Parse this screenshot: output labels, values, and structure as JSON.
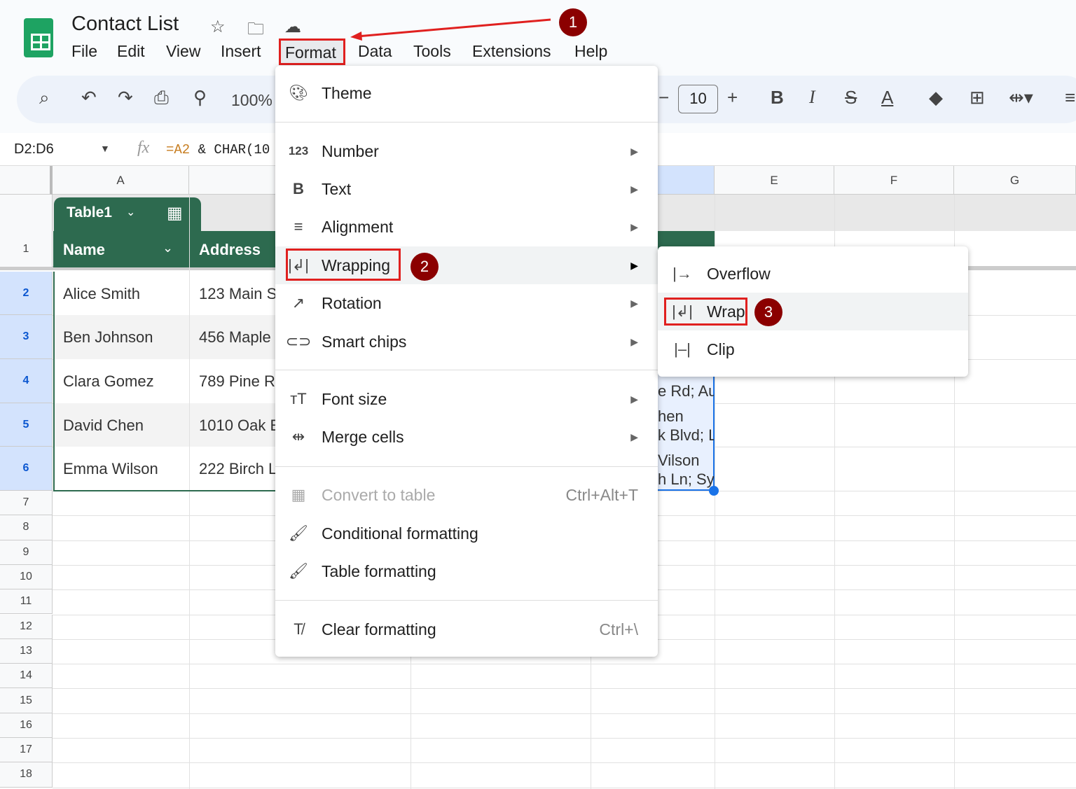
{
  "app": {
    "title": "Contact List"
  },
  "menubar": [
    "File",
    "Edit",
    "View",
    "Insert",
    "Format",
    "Data",
    "Tools",
    "Extensions",
    "Help"
  ],
  "toolbar": {
    "zoom": "100%",
    "font_size": "10",
    "minus": "−",
    "plus": "+"
  },
  "formula_bar": {
    "name_box": "D2:D6",
    "fx": "fx",
    "formula_prefix": "=A2",
    "formula_rest": " & CHAR(10"
  },
  "columns": [
    "A",
    "E",
    "F",
    "G"
  ],
  "rows": [
    "1",
    "2",
    "3",
    "4",
    "5",
    "6",
    "7",
    "8",
    "9",
    "10",
    "11",
    "12",
    "13",
    "14",
    "15",
    "16",
    "17",
    "18"
  ],
  "table": {
    "name": "Table1",
    "headers": [
      "Name",
      "Address"
    ],
    "rows": [
      [
        "Alice Smith",
        "123 Main S"
      ],
      [
        "Ben Johnson",
        "456 Maple"
      ],
      [
        "Clara Gomez",
        "789 Pine R"
      ],
      [
        "David Chen",
        "1010 Oak E"
      ],
      [
        "Emma Wilson",
        "222 Birch L"
      ]
    ]
  },
  "col_d_fragments": [
    "e Rd; Au",
    "hen",
    "k Blvd; L",
    "Vilson",
    "h Ln; Sy"
  ],
  "format_menu": {
    "items": [
      {
        "label": "Theme",
        "icon": "palette-icon"
      },
      {
        "label": "Number",
        "icon": "number-icon",
        "submenu": true
      },
      {
        "label": "Text",
        "icon": "bold-icon",
        "submenu": true
      },
      {
        "label": "Alignment",
        "icon": "align-icon",
        "submenu": true
      },
      {
        "label": "Wrapping",
        "icon": "wrap-icon",
        "submenu": true,
        "highlighted": true
      },
      {
        "label": "Rotation",
        "icon": "rotation-icon",
        "submenu": true
      },
      {
        "label": "Smart chips",
        "icon": "chip-icon",
        "submenu": true
      },
      {
        "label": "Font size",
        "icon": "font-size-icon",
        "submenu": true
      },
      {
        "label": "Merge cells",
        "icon": "merge-icon",
        "submenu": true
      },
      {
        "label": "Convert to table",
        "icon": "table-icon",
        "shortcut": "Ctrl+Alt+T",
        "disabled": true
      },
      {
        "label": "Conditional formatting",
        "icon": "paint-roller-icon"
      },
      {
        "label": "Table formatting",
        "icon": "paint-roller-icon"
      },
      {
        "label": "Clear formatting",
        "icon": "clear-format-icon",
        "shortcut": "Ctrl+\\"
      }
    ]
  },
  "wrapping_menu": {
    "items": [
      {
        "label": "Overflow"
      },
      {
        "label": "Wrap",
        "highlighted": true
      },
      {
        "label": "Clip"
      }
    ]
  },
  "annotations": [
    "1",
    "2",
    "3"
  ],
  "colors": {
    "accent": "#0b57d0",
    "table_header": "#2d6a4f",
    "annotation": "#8b0000",
    "highlight": "#e0201f"
  }
}
